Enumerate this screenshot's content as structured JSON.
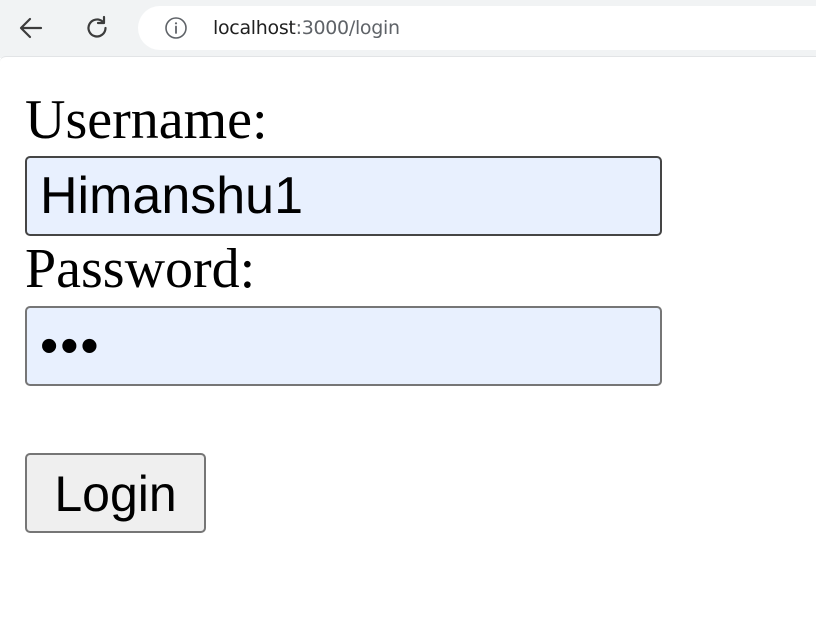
{
  "browser": {
    "url_host": "localhost",
    "url_path": ":3000/login",
    "icons": {
      "back": "arrow-left-icon",
      "reload": "reload-icon",
      "site_info": "info-icon"
    }
  },
  "form": {
    "username": {
      "label": "Username:",
      "value": "Himanshu1"
    },
    "password": {
      "label": "Password:",
      "value": "•••"
    },
    "login_button": "Login"
  },
  "colors": {
    "input_autofill_bg": "#e8f0fe",
    "button_bg": "#efefef",
    "chrome_bg": "#f1f3f4"
  }
}
